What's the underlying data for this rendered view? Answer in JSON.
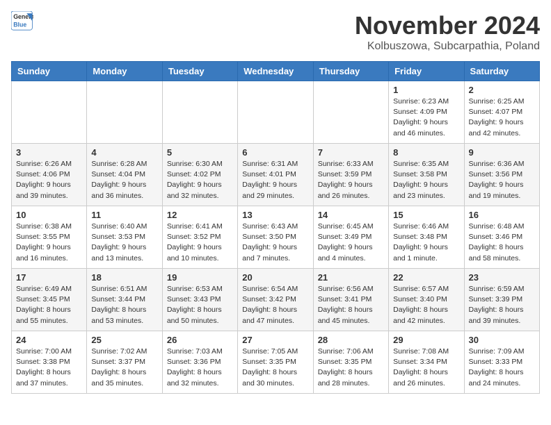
{
  "logo": {
    "general": "General",
    "blue": "Blue"
  },
  "title": "November 2024",
  "location": "Kolbuszowa, Subcarpathia, Poland",
  "headers": [
    "Sunday",
    "Monday",
    "Tuesday",
    "Wednesday",
    "Thursday",
    "Friday",
    "Saturday"
  ],
  "weeks": [
    [
      {
        "day": "",
        "info": ""
      },
      {
        "day": "",
        "info": ""
      },
      {
        "day": "",
        "info": ""
      },
      {
        "day": "",
        "info": ""
      },
      {
        "day": "",
        "info": ""
      },
      {
        "day": "1",
        "info": "Sunrise: 6:23 AM\nSunset: 4:09 PM\nDaylight: 9 hours and 46 minutes."
      },
      {
        "day": "2",
        "info": "Sunrise: 6:25 AM\nSunset: 4:07 PM\nDaylight: 9 hours and 42 minutes."
      }
    ],
    [
      {
        "day": "3",
        "info": "Sunrise: 6:26 AM\nSunset: 4:06 PM\nDaylight: 9 hours and 39 minutes."
      },
      {
        "day": "4",
        "info": "Sunrise: 6:28 AM\nSunset: 4:04 PM\nDaylight: 9 hours and 36 minutes."
      },
      {
        "day": "5",
        "info": "Sunrise: 6:30 AM\nSunset: 4:02 PM\nDaylight: 9 hours and 32 minutes."
      },
      {
        "day": "6",
        "info": "Sunrise: 6:31 AM\nSunset: 4:01 PM\nDaylight: 9 hours and 29 minutes."
      },
      {
        "day": "7",
        "info": "Sunrise: 6:33 AM\nSunset: 3:59 PM\nDaylight: 9 hours and 26 minutes."
      },
      {
        "day": "8",
        "info": "Sunrise: 6:35 AM\nSunset: 3:58 PM\nDaylight: 9 hours and 23 minutes."
      },
      {
        "day": "9",
        "info": "Sunrise: 6:36 AM\nSunset: 3:56 PM\nDaylight: 9 hours and 19 minutes."
      }
    ],
    [
      {
        "day": "10",
        "info": "Sunrise: 6:38 AM\nSunset: 3:55 PM\nDaylight: 9 hours and 16 minutes."
      },
      {
        "day": "11",
        "info": "Sunrise: 6:40 AM\nSunset: 3:53 PM\nDaylight: 9 hours and 13 minutes."
      },
      {
        "day": "12",
        "info": "Sunrise: 6:41 AM\nSunset: 3:52 PM\nDaylight: 9 hours and 10 minutes."
      },
      {
        "day": "13",
        "info": "Sunrise: 6:43 AM\nSunset: 3:50 PM\nDaylight: 9 hours and 7 minutes."
      },
      {
        "day": "14",
        "info": "Sunrise: 6:45 AM\nSunset: 3:49 PM\nDaylight: 9 hours and 4 minutes."
      },
      {
        "day": "15",
        "info": "Sunrise: 6:46 AM\nSunset: 3:48 PM\nDaylight: 9 hours and 1 minute."
      },
      {
        "day": "16",
        "info": "Sunrise: 6:48 AM\nSunset: 3:46 PM\nDaylight: 8 hours and 58 minutes."
      }
    ],
    [
      {
        "day": "17",
        "info": "Sunrise: 6:49 AM\nSunset: 3:45 PM\nDaylight: 8 hours and 55 minutes."
      },
      {
        "day": "18",
        "info": "Sunrise: 6:51 AM\nSunset: 3:44 PM\nDaylight: 8 hours and 53 minutes."
      },
      {
        "day": "19",
        "info": "Sunrise: 6:53 AM\nSunset: 3:43 PM\nDaylight: 8 hours and 50 minutes."
      },
      {
        "day": "20",
        "info": "Sunrise: 6:54 AM\nSunset: 3:42 PM\nDaylight: 8 hours and 47 minutes."
      },
      {
        "day": "21",
        "info": "Sunrise: 6:56 AM\nSunset: 3:41 PM\nDaylight: 8 hours and 45 minutes."
      },
      {
        "day": "22",
        "info": "Sunrise: 6:57 AM\nSunset: 3:40 PM\nDaylight: 8 hours and 42 minutes."
      },
      {
        "day": "23",
        "info": "Sunrise: 6:59 AM\nSunset: 3:39 PM\nDaylight: 8 hours and 39 minutes."
      }
    ],
    [
      {
        "day": "24",
        "info": "Sunrise: 7:00 AM\nSunset: 3:38 PM\nDaylight: 8 hours and 37 minutes."
      },
      {
        "day": "25",
        "info": "Sunrise: 7:02 AM\nSunset: 3:37 PM\nDaylight: 8 hours and 35 minutes."
      },
      {
        "day": "26",
        "info": "Sunrise: 7:03 AM\nSunset: 3:36 PM\nDaylight: 8 hours and 32 minutes."
      },
      {
        "day": "27",
        "info": "Sunrise: 7:05 AM\nSunset: 3:35 PM\nDaylight: 8 hours and 30 minutes."
      },
      {
        "day": "28",
        "info": "Sunrise: 7:06 AM\nSunset: 3:35 PM\nDaylight: 8 hours and 28 minutes."
      },
      {
        "day": "29",
        "info": "Sunrise: 7:08 AM\nSunset: 3:34 PM\nDaylight: 8 hours and 26 minutes."
      },
      {
        "day": "30",
        "info": "Sunrise: 7:09 AM\nSunset: 3:33 PM\nDaylight: 8 hours and 24 minutes."
      }
    ]
  ]
}
